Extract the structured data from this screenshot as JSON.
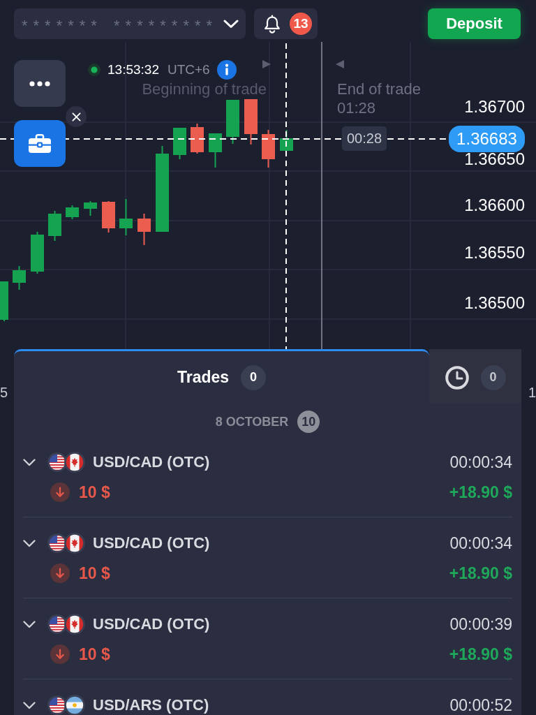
{
  "top_bar": {
    "account": {
      "value": "******* *********"
    },
    "notifications": {
      "count": "13"
    },
    "deposit_label": "Deposit"
  },
  "chart": {
    "online": true,
    "server_time": "13:53:32",
    "timezone": "UTC+6",
    "trade_start_label": "Beginning of trade",
    "trade_end_label": "End of trade",
    "trade_end_time": "01:28",
    "timer": "00:28",
    "current_price": "1.36683",
    "price_scale": [
      "1.36700",
      "1.36650",
      "1.36600",
      "1.36550",
      "1.36500"
    ],
    "time_scale": [
      "5",
      "1"
    ]
  },
  "trades_panel": {
    "tabs": [
      {
        "kind": "label",
        "label": "Trades",
        "count": "0",
        "selected": true
      },
      {
        "kind": "icon",
        "count": "0",
        "selected": false
      }
    ],
    "date_group": {
      "date": "8 OCTOBER",
      "count": "10"
    },
    "trades": [
      {
        "kind": "cad",
        "pair": "USD/CAD (OTC)",
        "expanded": false,
        "duration": "00:00:34",
        "up": false,
        "amount": "10 $",
        "profit": "+18.90 $",
        "won": true
      },
      {
        "kind": "cad",
        "pair": "USD/CAD (OTC)",
        "expanded": false,
        "duration": "00:00:34",
        "up": false,
        "amount": "10 $",
        "profit": "+18.90 $",
        "won": true
      },
      {
        "kind": "cad",
        "pair": "USD/CAD (OTC)",
        "expanded": false,
        "duration": "00:00:39",
        "up": false,
        "amount": "10 $",
        "profit": "+18.90 $",
        "won": true
      },
      {
        "kind": "ars",
        "pair": "USD/ARS (OTC)",
        "expanded": false,
        "duration": "00:00:52"
      }
    ]
  }
}
